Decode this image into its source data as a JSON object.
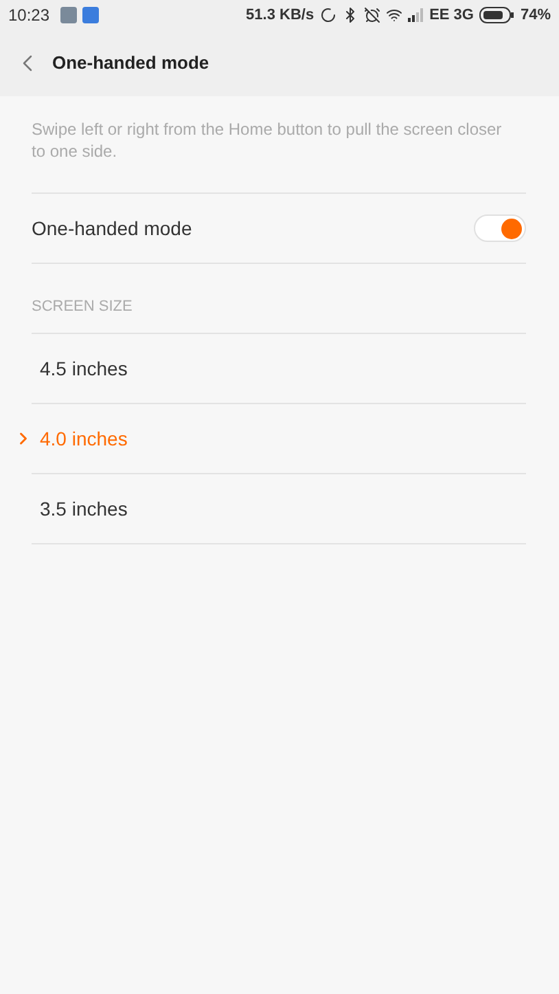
{
  "status_bar": {
    "time": "10:23",
    "speed": "51.3 KB/s",
    "carrier": "EE 3G",
    "battery": "74%"
  },
  "header": {
    "title": "One-handed mode"
  },
  "description": "Swipe left or right from the Home button to pull the screen closer to one side.",
  "toggle": {
    "label": "One-handed mode",
    "on": true
  },
  "section": {
    "title": "SCREEN SIZE"
  },
  "options": [
    {
      "label": "4.5 inches",
      "selected": false
    },
    {
      "label": "4.0 inches",
      "selected": true
    },
    {
      "label": "3.5 inches",
      "selected": false
    }
  ]
}
